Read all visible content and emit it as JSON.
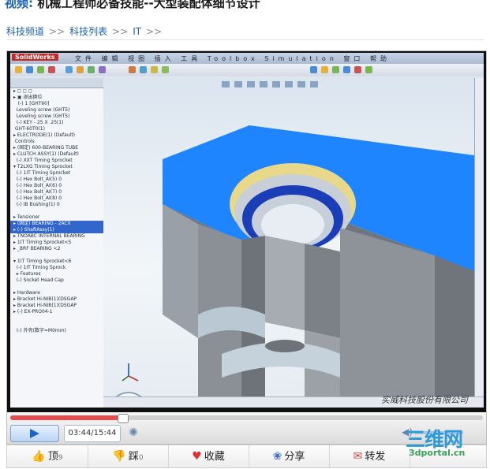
{
  "header": {
    "title_prefix": "视频:",
    "title_text": " 机械工程师必备技能--大型装配体细节设计",
    "breadcrumb": [
      "科技频道",
      "科技列表",
      "IT"
    ],
    "breadcrumb_sep": ">>"
  },
  "player": {
    "time": "03:44/15:44",
    "progress_fraction": 0.237
  },
  "video_frame": {
    "app_logo": "SolidWorks",
    "watermark": "实威科技股份有限公司"
  },
  "actions": [
    {
      "label": "顶",
      "count": "9",
      "icon": "thumbs-up-icon"
    },
    {
      "label": "踩",
      "count": "0",
      "icon": "thumbs-down-icon"
    },
    {
      "label": "收藏",
      "count": "",
      "icon": "heart-icon"
    },
    {
      "label": "分享",
      "count": "",
      "icon": "share-icon"
    },
    {
      "label": "转发",
      "count": "",
      "icon": "forward-icon"
    }
  ],
  "site_logo": {
    "big": "三维网",
    "small": "3dportal.cn"
  },
  "colors": {
    "accent": "#1b5fb3",
    "part_blue": "#1e7bff",
    "progress": "#e74c4c"
  }
}
